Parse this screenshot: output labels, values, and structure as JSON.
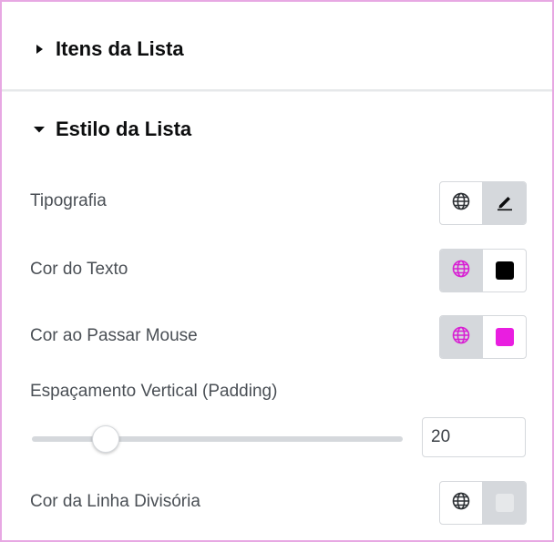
{
  "sections": {
    "itens": {
      "title": "Itens da Lista",
      "expanded": false
    },
    "estilo": {
      "title": "Estilo da Lista",
      "expanded": true
    }
  },
  "controls": {
    "tipografia": {
      "label": "Tipografia",
      "globe_icon": "globe-icon",
      "edit_icon": "pencil-icon"
    },
    "cor_texto": {
      "label": "Cor do Texto",
      "globe_icon": "globe-icon",
      "swatch_color": "#000000",
      "globe_color": "#d81fd3"
    },
    "cor_hover": {
      "label": "Cor ao Passar Mouse",
      "globe_icon": "globe-icon",
      "swatch_color": "#e91ee0",
      "globe_color": "#d81fd3"
    },
    "espacamento": {
      "label": "Espaçamento Vertical (Padding)",
      "value": "20",
      "slider_fraction": 0.2
    },
    "cor_linha": {
      "label": "Cor da Linha Divisória",
      "globe_icon": "globe-icon",
      "swatch_color": "#e6e8ea"
    }
  },
  "colors": {
    "accent": "#d81fd3",
    "border": "#e7a8e3"
  }
}
